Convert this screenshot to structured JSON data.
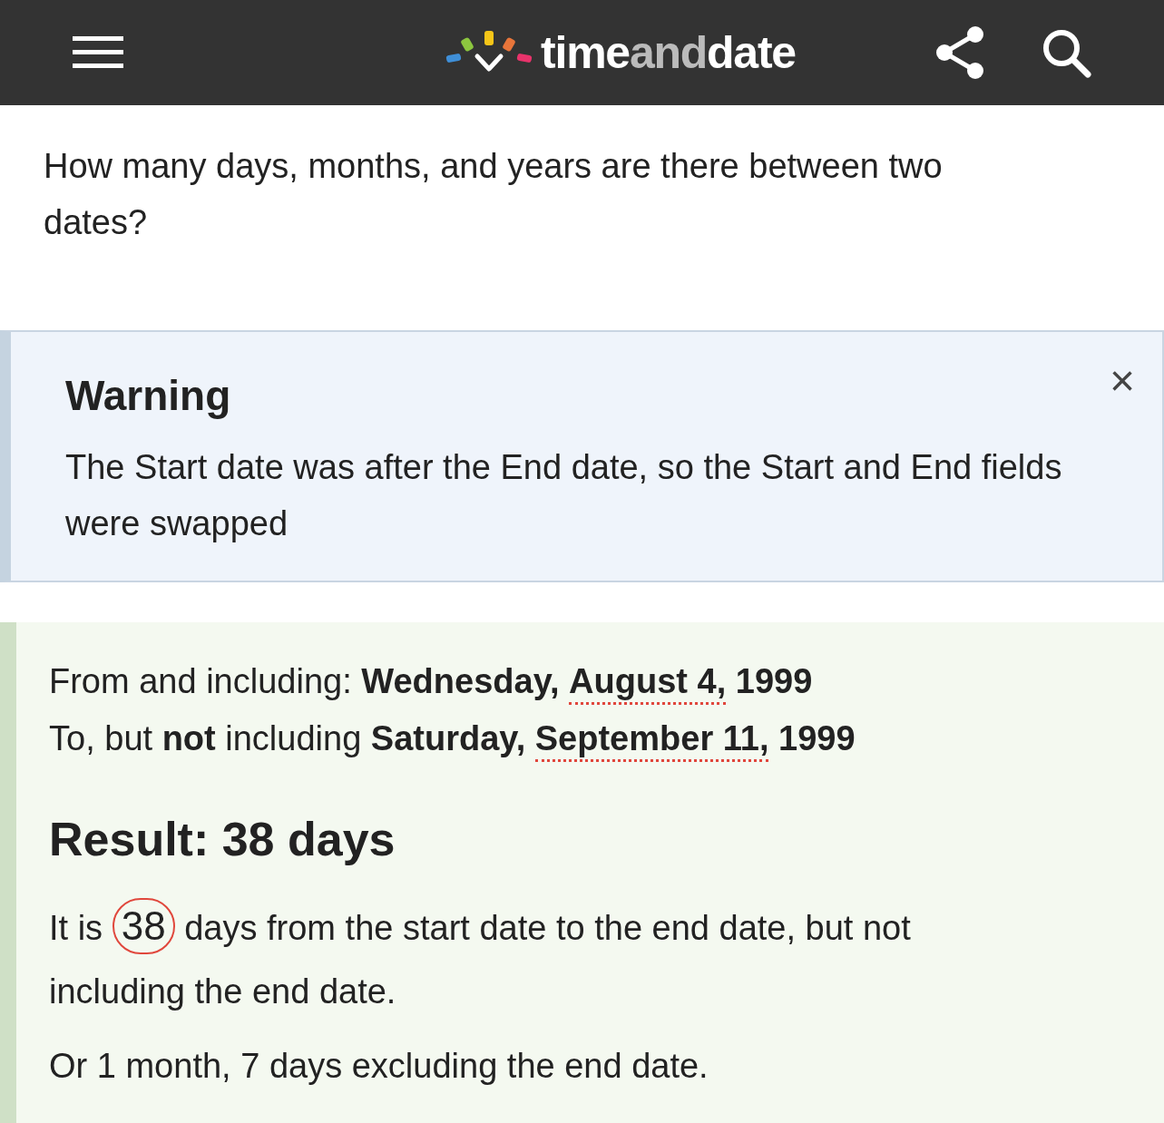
{
  "header": {
    "logo": {
      "text_a": "time",
      "text_b": "and",
      "text_c": "date"
    }
  },
  "page": {
    "intro": "How many days, months, and years are there between two dates?"
  },
  "warning": {
    "title": "Warning",
    "message": "The Start date was after the End date, so the Start and End fields were swapped",
    "close": "×"
  },
  "result": {
    "lines": [
      [
        {
          "text": "From and including: "
        },
        {
          "text": "Wednesday, ",
          "bold": true
        },
        {
          "text": "August 4,",
          "bold": true,
          "underlined": true
        },
        {
          "text": " 1999",
          "bold": true
        }
      ],
      [
        {
          "text": "To, but "
        },
        {
          "text": "not",
          "bold": true
        },
        {
          "text": " including "
        },
        {
          "text": "Saturday, ",
          "bold": true
        },
        {
          "text": "September 11,",
          "bold": true,
          "underlined": true
        },
        {
          "text": " 1999",
          "bold": true
        }
      ]
    ],
    "heading": "Result: 38 days",
    "paragraphs": [
      [
        {
          "text": "It is "
        },
        {
          "text": "38",
          "circled": true
        },
        {
          "text": " days from the start date to the end date, but not including the end date."
        }
      ],
      [
        {
          "text": "Or 1 month, 7 days excluding the end date."
        }
      ]
    ]
  }
}
